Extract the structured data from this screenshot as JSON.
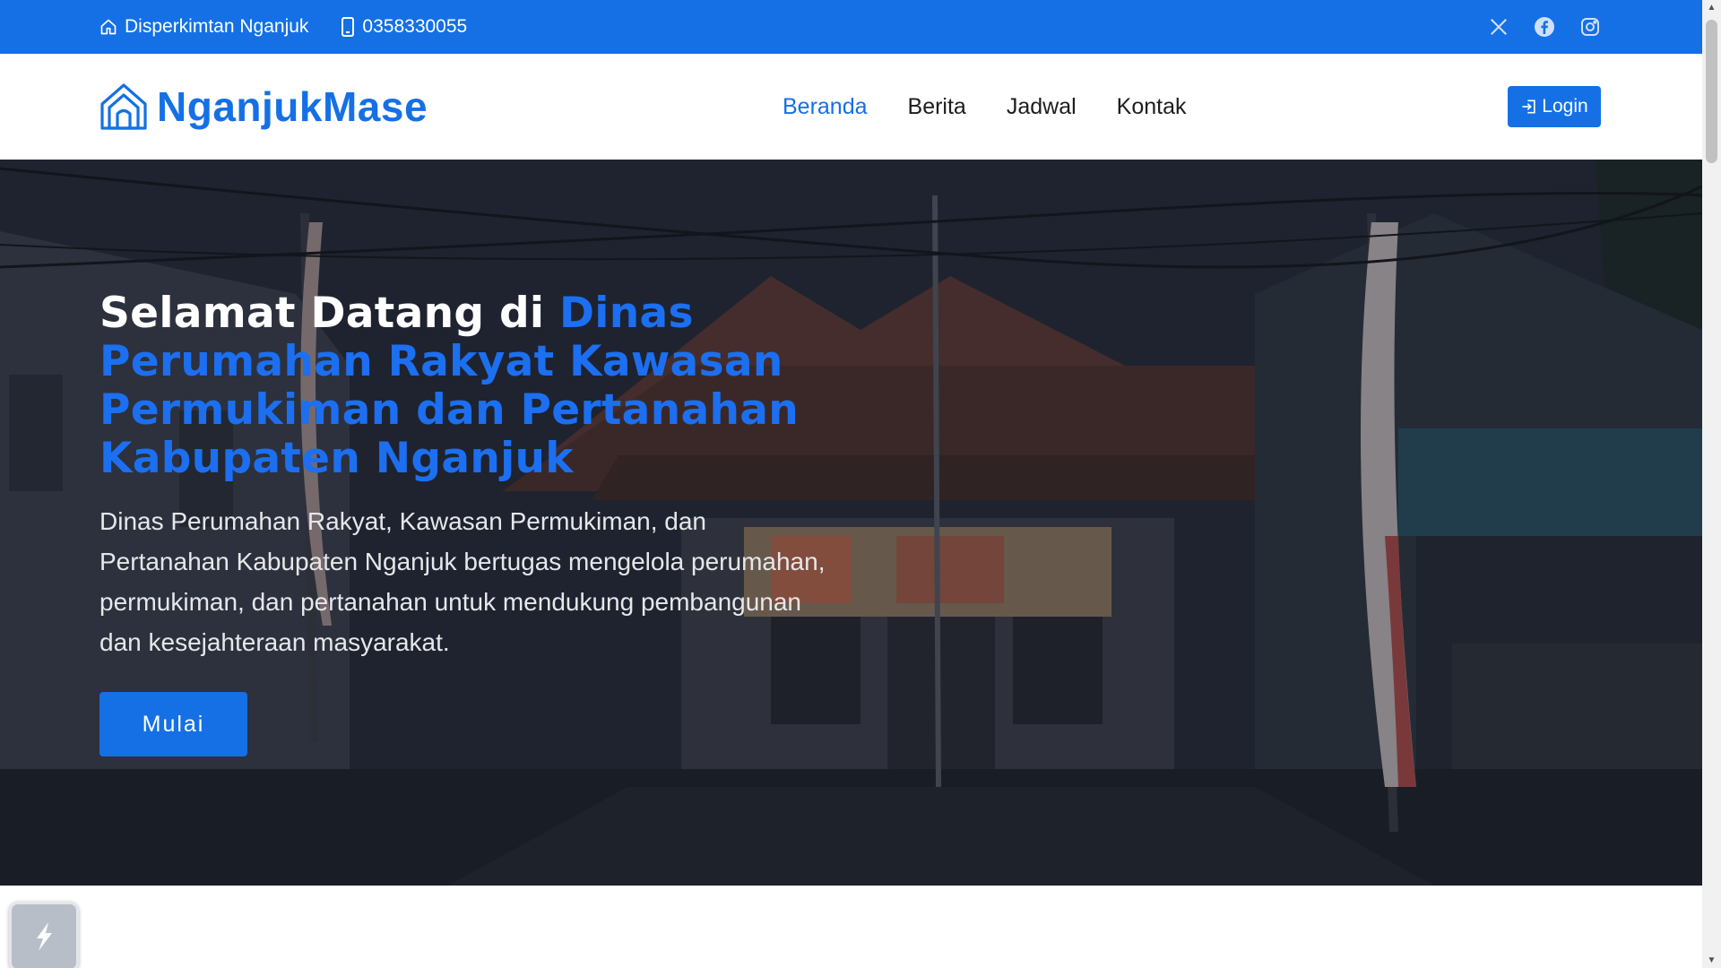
{
  "topbar": {
    "org_name": "Disperkimtan Nganjuk",
    "phone": "0358330055",
    "social": [
      {
        "icon": "x-twitter-icon"
      },
      {
        "icon": "facebook-icon"
      },
      {
        "icon": "instagram-icon"
      }
    ]
  },
  "navbar": {
    "brand": "NganjukMase",
    "menu": [
      "Beranda",
      "Berita",
      "Jadwal",
      "Kontak"
    ],
    "active_item": "Beranda",
    "login_label": "Login"
  },
  "hero": {
    "title_prefix": "Selamat Datang di ",
    "title_highlight": "Dinas Perumahan Rakyat Kawasan Permukiman dan Pertanahan Kabupaten Nganjuk",
    "description": "Dinas Perumahan Rakyat, Kawasan Permukiman, dan Pertanahan Kabupaten Nganjuk bertugas mengelola perumahan, permukiman, dan pertanahan untuk mendukung pembangunan dan kesejahteraan masyarakat.",
    "cta_label": "Mulai"
  },
  "colors": {
    "primary": "#1570e5",
    "topbar_bg": "#1570e5",
    "hero_highlight": "#1c6ff0"
  },
  "scrollbar": {
    "up_glyph": "▲",
    "down_glyph": "▼"
  }
}
